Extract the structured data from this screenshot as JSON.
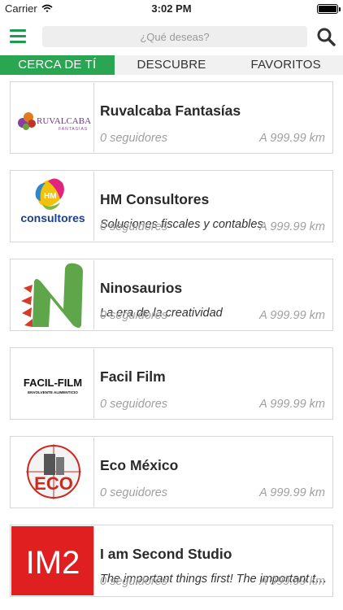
{
  "status_bar": {
    "carrier": "Carrier",
    "time": "3:02 PM"
  },
  "search": {
    "placeholder": "¿Qué deseas?"
  },
  "tabs": [
    {
      "label": "CERCA DE TÍ"
    },
    {
      "label": "DESCUBRE"
    },
    {
      "label": "FAVORITOS"
    }
  ],
  "colors": {
    "accent_green": "#2aa652",
    "icon_green": "#1f9a4f"
  },
  "businesses": [
    {
      "name": "Ruvalcaba Fantasías",
      "description": "",
      "followers": "0 seguidores",
      "distance": "A 999.99 km",
      "logo_text": "RUVALCABA",
      "logo_subtext": "FANTASÍAS"
    },
    {
      "name": "HM Consultores",
      "description": "Soluciones fiscales y contables.",
      "followers": "0 seguidores",
      "distance": "A 999.99 km",
      "logo_text": "consultores",
      "logo_subtext": "HM"
    },
    {
      "name": "Ninosaurios",
      "description": "La era de la creatividad",
      "followers": "0 seguidores",
      "distance": "A 999.99 km",
      "logo_text": "",
      "logo_subtext": ""
    },
    {
      "name": "Facil Film",
      "description": "",
      "followers": "0 seguidores",
      "distance": "A 999.99 km",
      "logo_text": "FACIL-FILM",
      "logo_subtext": "ENVOLVENTE ALIMENTICIO"
    },
    {
      "name": "Eco México",
      "description": "",
      "followers": "0 seguidores",
      "distance": "A 999.99 km",
      "logo_text": "ECO",
      "logo_subtext": ""
    },
    {
      "name": "I am Second Studio",
      "description": "The important things first! The important things first!",
      "followers": "0 seguidores",
      "distance": "A 999.99 km",
      "logo_text": "IM2",
      "logo_subtext": ""
    }
  ]
}
